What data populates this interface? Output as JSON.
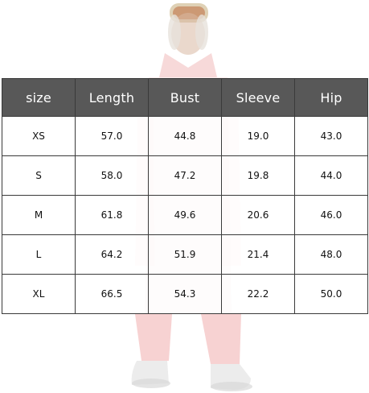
{
  "image": {
    "alt": "model in pink ski suit",
    "colors": {
      "header_bg": "#585858",
      "header_text": "#ffffff",
      "border": "#3a3a3a",
      "suit": "#f6d4d4"
    }
  },
  "size_chart": {
    "columns": [
      "size",
      "Length",
      "Bust",
      "Sleeve",
      "Hip"
    ],
    "rows": [
      [
        "XS",
        "57.0",
        "44.8",
        "19.0",
        "43.0"
      ],
      [
        "S",
        "58.0",
        "47.2",
        "19.8",
        "44.0"
      ],
      [
        "M",
        "61.8",
        "49.6",
        "20.6",
        "46.0"
      ],
      [
        "L",
        "64.2",
        "51.9",
        "21.4",
        "48.0"
      ],
      [
        "XL",
        "66.5",
        "54.3",
        "22.2",
        "50.0"
      ]
    ]
  }
}
